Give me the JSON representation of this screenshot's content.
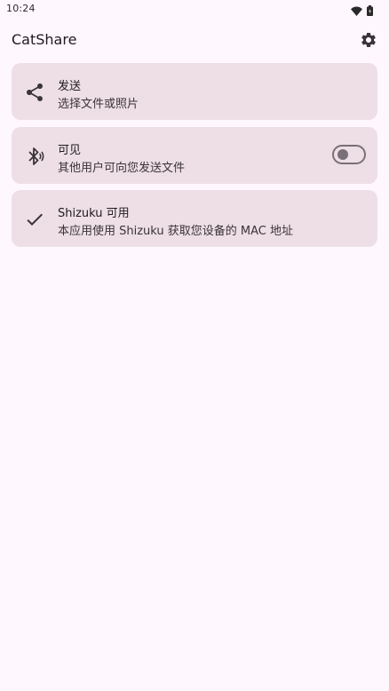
{
  "status_bar": {
    "time": "10:24",
    "icons": [
      "wifi-icon",
      "battery-icon"
    ]
  },
  "app_bar": {
    "title": "CatShare",
    "settings_icon": "gear-icon"
  },
  "cards": [
    {
      "icon": "share-icon",
      "title": "发送",
      "subtitle": "选择文件或照片"
    },
    {
      "icon": "bluetooth-icon",
      "title": "可见",
      "subtitle": "其他用户可向您发送文件",
      "toggle_on": false
    },
    {
      "icon": "check-icon",
      "title": "Shizuku 可用",
      "subtitle": "本应用使用 Shizuku 获取您设备的 MAC 地址"
    }
  ],
  "colors": {
    "background": "#FFF7FE",
    "card": "#EEDFE6",
    "text": "#1F1A1F",
    "toggle_outline": "#7A7077"
  }
}
